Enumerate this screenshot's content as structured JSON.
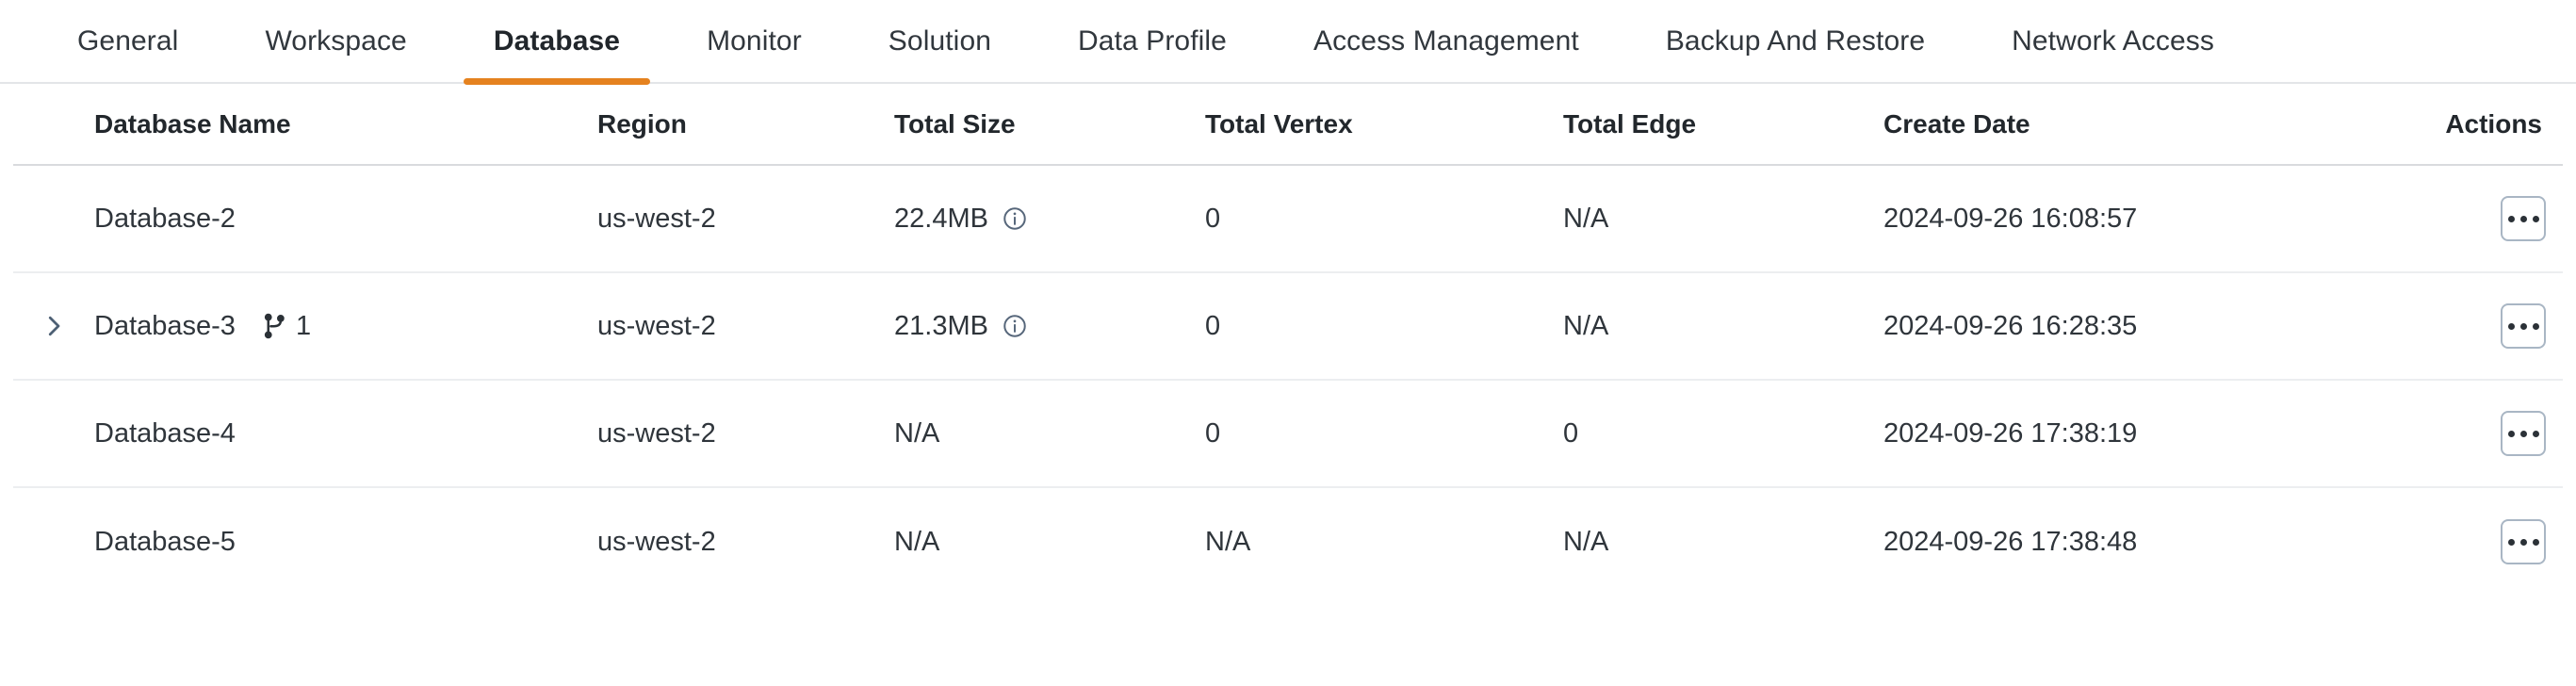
{
  "tabs": [
    {
      "label": "General",
      "active": false
    },
    {
      "label": "Workspace",
      "active": false
    },
    {
      "label": "Database",
      "active": true
    },
    {
      "label": "Monitor",
      "active": false
    },
    {
      "label": "Solution",
      "active": false
    },
    {
      "label": "Data Profile",
      "active": false
    },
    {
      "label": "Access Management",
      "active": false
    },
    {
      "label": "Backup And Restore",
      "active": false
    },
    {
      "label": "Network Access",
      "active": false
    }
  ],
  "table": {
    "columns": [
      {
        "key": "name",
        "label": "Database Name"
      },
      {
        "key": "region",
        "label": "Region"
      },
      {
        "key": "size",
        "label": "Total Size"
      },
      {
        "key": "vertex",
        "label": "Total Vertex"
      },
      {
        "key": "edge",
        "label": "Total Edge"
      },
      {
        "key": "date",
        "label": "Create Date"
      },
      {
        "key": "actions",
        "label": "Actions"
      }
    ],
    "rows": [
      {
        "name": "Database-2",
        "expandable": false,
        "branch_count": null,
        "region": "us-west-2",
        "size": "22.4MB",
        "size_info": true,
        "vertex": "0",
        "edge": "N/A",
        "date": "2024-09-26 16:08:57",
        "actions_label": "•••"
      },
      {
        "name": "Database-3",
        "expandable": true,
        "branch_count": "1",
        "region": "us-west-2",
        "size": "21.3MB",
        "size_info": true,
        "vertex": "0",
        "edge": "N/A",
        "date": "2024-09-26 16:28:35",
        "actions_label": "•••"
      },
      {
        "name": "Database-4",
        "expandable": false,
        "branch_count": null,
        "region": "us-west-2",
        "size": "N/A",
        "size_info": false,
        "vertex": "0",
        "edge": "0",
        "date": "2024-09-26 17:38:19",
        "actions_label": "•••"
      },
      {
        "name": "Database-5",
        "expandable": false,
        "branch_count": null,
        "region": "us-west-2",
        "size": "N/A",
        "size_info": false,
        "vertex": "N/A",
        "edge": "N/A",
        "date": "2024-09-26 17:38:48",
        "actions_label": "•••"
      }
    ]
  },
  "icons": {
    "expand": "chevron-right-icon",
    "branch": "git-branch-icon",
    "info": "info-circle-icon",
    "actions": "ellipsis-icon"
  },
  "colors": {
    "accent": "#e5821f",
    "text": "#2f353b",
    "border": "#eceef0",
    "header_border": "#d9dbde",
    "icon_muted": "#56667a",
    "button_border": "#a9b6c4"
  }
}
